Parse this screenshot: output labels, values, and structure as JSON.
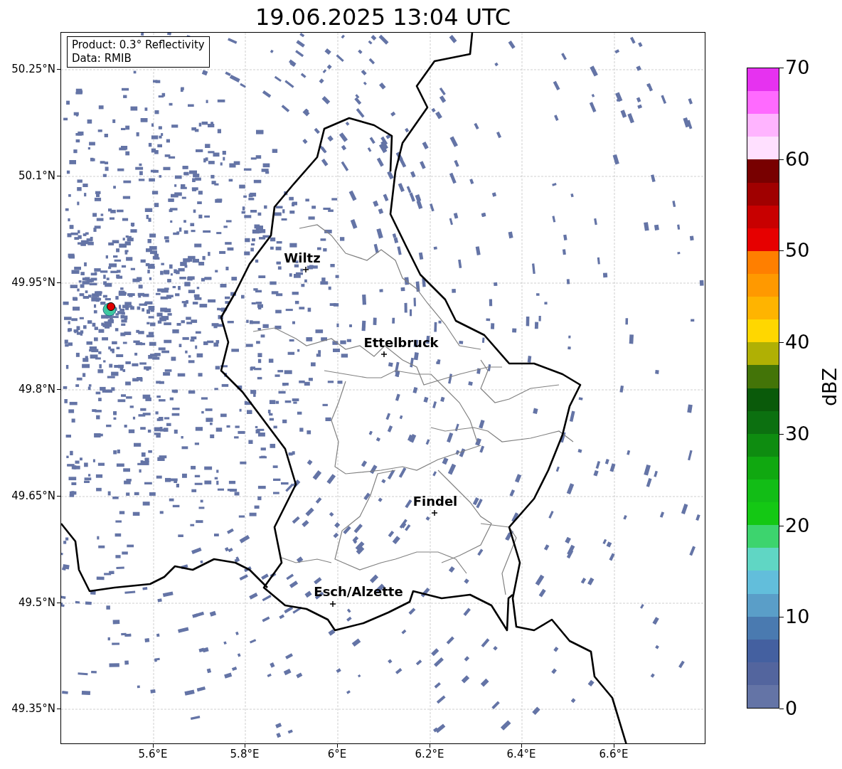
{
  "title": "19.06.2025 13:04 UTC",
  "legend": [
    "Product: 0.3° Reflectivity",
    "Data: RMIB"
  ],
  "x_ticks": [
    "5.6°E",
    "5.8°E",
    "6°E",
    "6.2°E",
    "6.4°E",
    "6.6°E"
  ],
  "y_ticks": [
    "50.25°N",
    "50.1°N",
    "49.95°N",
    "49.8°N",
    "49.65°N",
    "49.5°N",
    "49.35°N"
  ],
  "cities": [
    {
      "name": "Wiltz"
    },
    {
      "name": "Ettelbruck"
    },
    {
      "name": "Findel"
    },
    {
      "name": "Esch/Alzette"
    }
  ],
  "colorbar": {
    "label": "dBZ",
    "ticks": [
      "70",
      "60",
      "50",
      "40",
      "30",
      "20",
      "10",
      "0"
    ],
    "segments": [
      {
        "color": "#e632f0"
      },
      {
        "color": "#ff6aff"
      },
      {
        "color": "#ffb4ff"
      },
      {
        "color": "#ffe0ff"
      },
      {
        "color": "#780000"
      },
      {
        "color": "#a00000"
      },
      {
        "color": "#c80000"
      },
      {
        "color": "#e60000"
      },
      {
        "color": "#ff7f00"
      },
      {
        "color": "#ff9900"
      },
      {
        "color": "#ffb400"
      },
      {
        "color": "#ffd700"
      },
      {
        "color": "#b0b004"
      },
      {
        "color": "#437408"
      },
      {
        "color": "#0a5a0a"
      },
      {
        "color": "#0c7010"
      },
      {
        "color": "#0e8c10"
      },
      {
        "color": "#10a810"
      },
      {
        "color": "#12bd16"
      },
      {
        "color": "#14c814"
      },
      {
        "color": "#3dd46e"
      },
      {
        "color": "#60d6c4"
      },
      {
        "color": "#62bedb"
      },
      {
        "color": "#5a9ec8"
      },
      {
        "color": "#4a7ab0"
      },
      {
        "color": "#4460a0"
      },
      {
        "color": "#53659e"
      },
      {
        "color": "#6474a6"
      }
    ]
  }
}
